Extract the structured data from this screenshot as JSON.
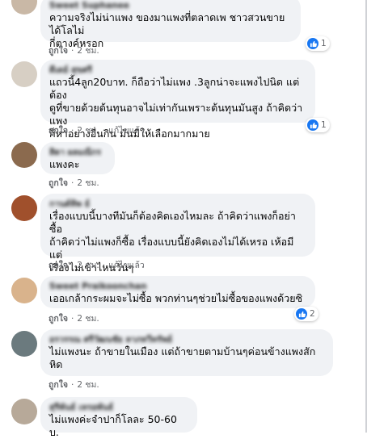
{
  "colors": {
    "bubble": "#f0f2f5",
    "like_blue": "#1877f2",
    "meta_gray": "#65676b"
  },
  "actions": {
    "like": "ถูกใจ",
    "edited": "แก้ไขแล้ว",
    "dot": "·"
  },
  "comments": [
    {
      "name": "Sweet Suphanee",
      "text": "ความจริงไม่น่าแพง ของมาแพงที่ตลาดเพ ชาวสวนขายได้โลไม่\nกี่ตางค์หรอก",
      "time": "2 ชม.",
      "edited": false,
      "reactions": "1"
    },
    {
      "name": "ดีเดย์ สุขศรี",
      "text": "แถวนี้4ลูก20บาท. ก็ถือว่าไม่แพง .3ลูกน่าจะแพงไปนิด แต่ต้อง\nดูที่ขายด้วยต้นทุนอาจไม่เท่ากันเพราะต้นทุนมันสูง ถ้าคิดว่าแพง\nก็หาอย่างอื่นกิน มันมีให้เลือกมากมาย",
      "time": "2 ชม.",
      "edited": true,
      "reactions": "1"
    },
    {
      "name": "สิดา ผลมณีกร",
      "text": "แพงคะ",
      "time": "2 ชม.",
      "edited": false,
      "reactions": ""
    },
    {
      "name": "กานต์ทิพ ย์",
      "text": "เรื่องแบบนี้บางทีมันก็ต้องคิดเองไหมละ ถ้าคิดว่าแพงก็อย่าซื้อ\nถ้าคิดว่าไม่แพงก็ซื้อ เรื่องแบบนี้ยังคิดเองไม่ได้เหรอ เห้อมีแต่\nเรื่องไม่เข้าไหนวันๆ",
      "time": "2 ชม.",
      "edited": true,
      "reactions": ""
    },
    {
      "name": "Sweet Praikoonchan",
      "text": "เออเกล้ากระผมจะไม่ซื้อ พวกท่านๆช่วยไม่ซื้อของแพงด้วยซิ",
      "time": "2 ชม.",
      "edited": false,
      "reactions": "2"
    },
    {
      "name": "อรวรรณ ศรีวัฒนชัย ลาภทวีทรัพย์",
      "text": "ไม่แพงนะ ถ้าขายในเมือง แต่ถ้าขายตามบ้านๆค่อนข้างแพงสัก\nหิด",
      "time": "2 ชม.",
      "edited": false,
      "reactions": ""
    },
    {
      "name": "สุรีพันธ์ เหรอพันธ์",
      "text": "ไม่แพงค่ะจำปาก็โลละ 50-60 บ.",
      "time": "",
      "edited": false,
      "reactions": ""
    }
  ]
}
